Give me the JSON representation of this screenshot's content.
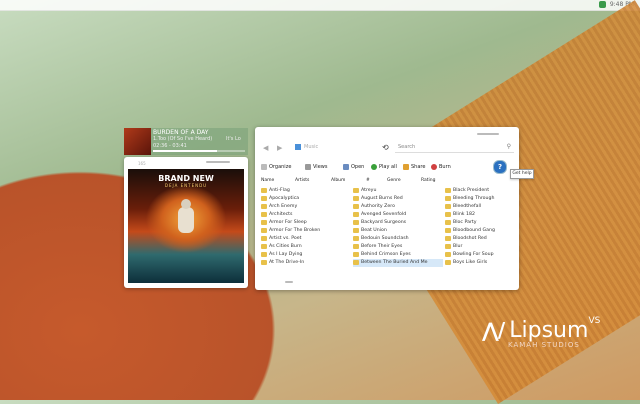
{
  "topbar": {
    "clock": "9:48 PM"
  },
  "brand": {
    "name": "Lipsum",
    "suffix": "VS",
    "subtitle": "KAMAH STUDIOS"
  },
  "now_playing": {
    "album_title": "BURDEN OF A DAY",
    "track": "1.Too (Of So I've Heard)",
    "artist": "It's Lo",
    "time": "02:36 - 03:41",
    "progress": 0.7
  },
  "album_card": {
    "number": "165",
    "band": "BRAND NEW",
    "record": "DEJA ENTENDU"
  },
  "explorer": {
    "address": "Music",
    "search_placeholder": "Search",
    "toolbar": {
      "organize": "Organize",
      "views": "Views",
      "open": "Open",
      "play_all": "Play all",
      "share": "Share",
      "burn": "Burn",
      "help": "?"
    },
    "tooltip": "Get help",
    "columns": [
      "Name",
      "Artists",
      "Album",
      "#",
      "Genre",
      "Rating"
    ],
    "folders_col1": [
      "Anti-Flag",
      "Apocalyptica",
      "Arch Enemy",
      "Architects",
      "Armor For Sleep",
      "Armor For The Broken",
      "Artist vs. Poet",
      "As Cities Burn",
      "As I Lay Dying",
      "At The Drive-In"
    ],
    "folders_col2": [
      "Atreyu",
      "August Burns Red",
      "Authority Zero",
      "Avenged Sevenfold",
      "Backyard Surgeons",
      "Beat Union",
      "Bedouin Soundclash",
      "Before Their Eyes",
      "Behind Crimson Eyes",
      "Between The Buried And Me"
    ],
    "folders_col3": [
      "Black President",
      "Bleeding Through",
      "Bleedthefall",
      "Blink 182",
      "Bloc Party",
      "Bloodbound Gang",
      "Bloodshot Red",
      "Blur",
      "Bowling For Soup",
      "Boys Like Girls"
    ],
    "selected_col2_index": 9
  }
}
